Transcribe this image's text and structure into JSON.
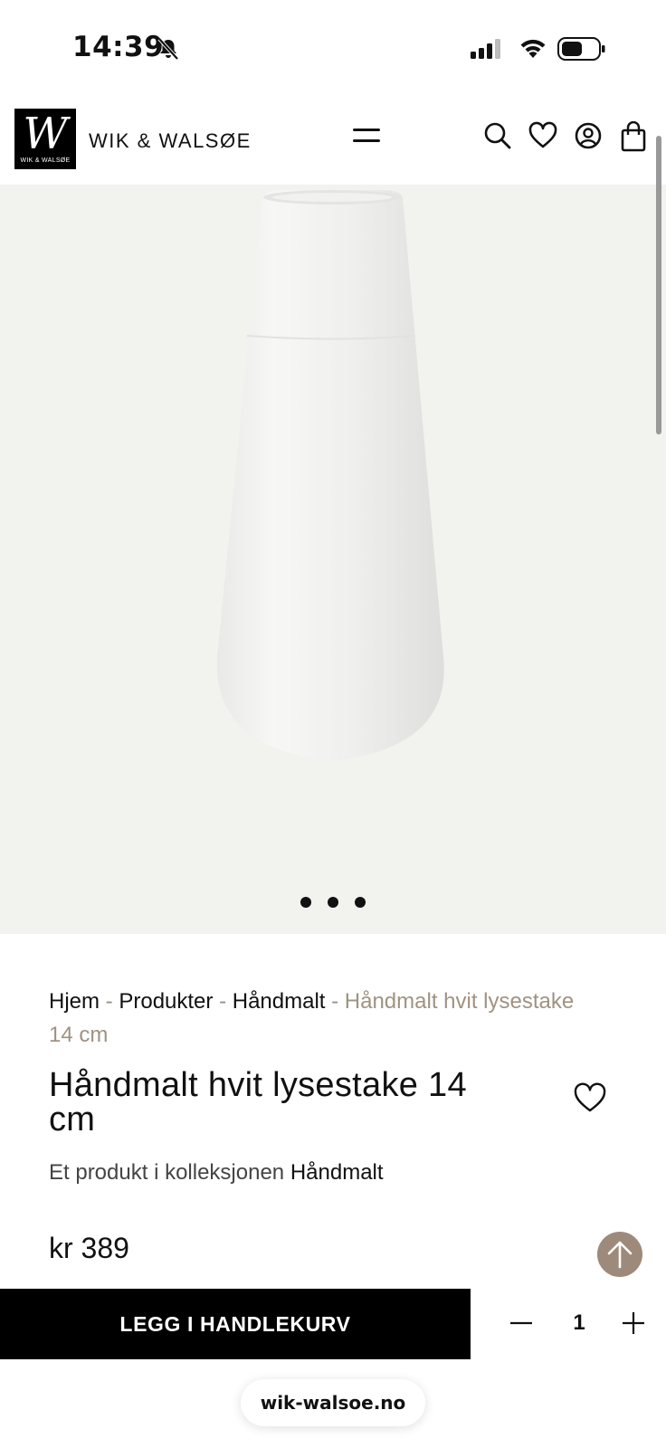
{
  "status_bar": {
    "time": "14:39",
    "icons": [
      "bell-muted-icon",
      "cellular-signal-icon",
      "wifi-icon",
      "battery-icon"
    ]
  },
  "header": {
    "logo_letter": "W",
    "logo_small_text": "WIK & WALSØE",
    "brand_name": "WIK & WALSØE",
    "icons": [
      "menu-icon",
      "search-icon",
      "heart-icon",
      "account-icon",
      "shopping-bag-icon"
    ]
  },
  "gallery": {
    "image_description_icon": "white-vase-image",
    "dot_count": 3
  },
  "breadcrumb": {
    "items": [
      "Hjem",
      "Produkter",
      "Håndmalt"
    ],
    "separator": " - ",
    "current": "Håndmalt hvit lysestake 14 cm"
  },
  "product": {
    "title": "Håndmalt hvit lysestake 14 cm",
    "collection_prefix": "Et produkt i kolleksjonen",
    "collection_name": "Håndmalt",
    "price": "kr 389"
  },
  "cart": {
    "add_label": "LEGG I HANDLEKURV",
    "quantity": "1"
  },
  "browser": {
    "url": "wik-walsoe.no"
  },
  "colors": {
    "accent_taupe": "#9e8a7b",
    "breadcrumb_current": "#a09282",
    "gallery_bg": "#f2f2ef",
    "button_bg": "#000000"
  }
}
